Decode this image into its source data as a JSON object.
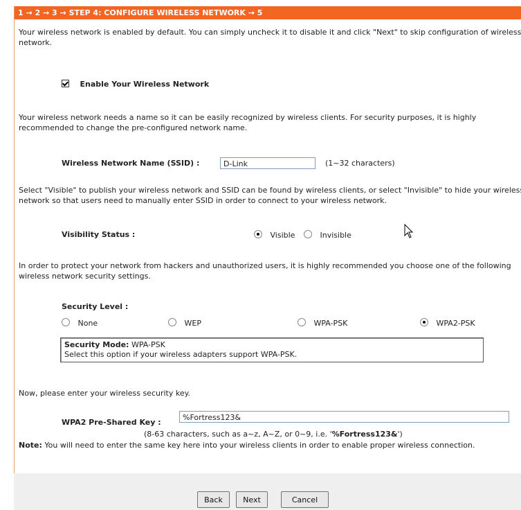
{
  "header": {
    "title": "1 → 2 → 3 → STEP 4: CONFIGURE WIRELESS NETWORK → 5"
  },
  "intro": "Your wireless network is enabled by default. You can simply uncheck it to disable it and click \"Next\" to skip configuration of wireless network.",
  "enable": {
    "label": "Enable Your Wireless Network",
    "checked": true
  },
  "ssid_intro": "Your wireless network needs a name so it can be easily recognized by wireless clients. For security purposes, it is highly recommended to change the pre-configured network name.",
  "ssid": {
    "label": "Wireless Network Name (SSID) :",
    "value": "D-Link",
    "hint": "(1~32 characters)"
  },
  "visibility_intro": "Select \"Visible\" to publish your wireless network and SSID can be found by wireless clients, or select \"Invisible\" to hide your wireless network so that users need to manually enter SSID in order to connect to your wireless network.",
  "visibility": {
    "label": "Visibility Status :",
    "options": [
      "Visible",
      "Invisible"
    ],
    "selected": "Visible"
  },
  "security_intro": "In order to protect your network from hackers and unauthorized users, it is highly recommended you choose one of the following wireless network security settings.",
  "security": {
    "label": "Security Level :",
    "options": [
      "None",
      "WEP",
      "WPA-PSK",
      "WPA2-PSK"
    ],
    "selected": "WPA2-PSK",
    "mode_title": "Security Mode:",
    "mode_value": "WPA-PSK",
    "mode_desc": "Select this option if your wireless adapters support WPA-PSK."
  },
  "key_intro": "Now, please enter your wireless security key.",
  "key": {
    "label": "WPA2 Pre-Shared Key :",
    "value": "%Fortress123&",
    "hint_prefix": "(8-63 characters, such as a~z, A~Z, or 0~9, i.e. '",
    "hint_example": "%Fortress123&",
    "hint_suffix": "')"
  },
  "note": {
    "label": "Note:",
    "text": "You will need to enter the same key here into your wireless clients in order to enable proper wireless connection."
  },
  "buttons": {
    "back": "Back",
    "next": "Next",
    "cancel": "Cancel"
  }
}
